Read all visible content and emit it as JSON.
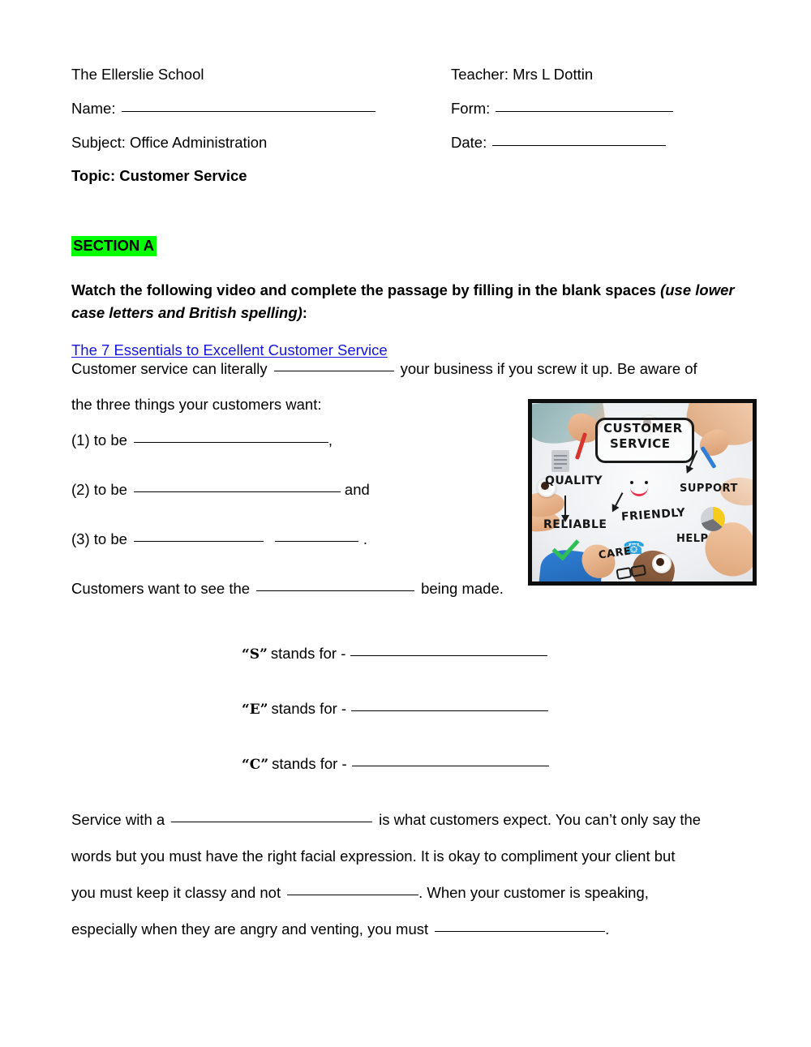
{
  "header": {
    "school": "The Ellerslie School",
    "teacher": "Teacher: Mrs L Dottin",
    "name_label": "Name:",
    "form_label": "Form:",
    "subject": "Subject: Office Administration",
    "date_label": "Date:",
    "topic": "Topic: Customer Service"
  },
  "section": {
    "badge": "SECTION A",
    "highlight_color": "#00ff00",
    "instruction_main": "Watch the following video and complete the passage by filling in the blank spaces ",
    "instruction_italic": "(use lower case letters and British spelling)",
    "instruction_tail": ":",
    "video_link": "The 7 Essentials to Excellent Customer Service",
    "link_color": "#1414dd"
  },
  "passage": {
    "line1_a": "Customer service can literally",
    "line1_b": "your business if you screw it up. Be aware of",
    "line2": "the three things your customers want:",
    "item1_a": "(1) to be",
    "item1_b": ",",
    "item2_a": "(2) to be",
    "item2_b": "and",
    "item3_a": "(3) to be",
    "item3_b": ".",
    "process_a": "Customers want to see the",
    "process_b": "being made."
  },
  "acronym": {
    "rows": [
      {
        "letter": "S",
        "text": "stands for -"
      },
      {
        "letter": "E",
        "text": "stands for -"
      },
      {
        "letter": "C",
        "text": "stands for -"
      }
    ],
    "open_quote": "“",
    "close_quote": "”"
  },
  "closing": {
    "l1_a": "Service with a",
    "l1_b": "is what customers expect. You can’t only say the",
    "l2": "words but you must have the right facial expression. It is okay to compliment your client but",
    "l3_a": "you must keep it classy and not",
    "l3_b": ".  When your customer is speaking,",
    "l4_a": "especially when they are angry and venting, you must",
    "l4_b": "."
  },
  "photo": {
    "center_line1": "CUSTOMER",
    "center_line2": "SERVICE",
    "words": {
      "quality": "QUALITY",
      "support": "SUPPORT",
      "reliable": "RELIABLE",
      "friendly": "FRIENDLY",
      "care": "CARE",
      "help": "HELP"
    }
  }
}
